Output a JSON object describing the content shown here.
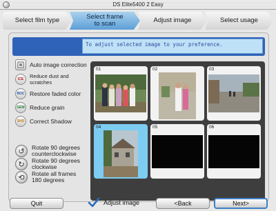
{
  "window": {
    "title": "DS Elite5400 2 Easy"
  },
  "steps": [
    {
      "label": "Select film type"
    },
    {
      "label": "Select frame to scan"
    },
    {
      "label": "Adjust image"
    },
    {
      "label": "Select usage"
    }
  ],
  "active_step": "Select frame to scan",
  "banner": {
    "text": "To adjust selected image to your preference."
  },
  "tools": [
    {
      "label": "Auto image correction",
      "icon": "auto-correction-icon",
      "badge": ""
    },
    {
      "label": "Reduce dust and scratches",
      "icon": "ice-icon",
      "badge": "ICE"
    },
    {
      "label": "Restore faded color",
      "icon": "roc-icon",
      "badge": "ROC"
    },
    {
      "label": "Reduce grain",
      "icon": "gem-icon",
      "badge": "GEM"
    },
    {
      "label": "Correct Shadow",
      "icon": "shadow-icon",
      "badge": "SHD"
    }
  ],
  "rotate": [
    {
      "line1": "Rotate 90 degrees",
      "line2": "counterclockwise",
      "icon": "rotate-ccw-icon"
    },
    {
      "line1": "Rotate 90 degrees",
      "line2": "clockwise",
      "icon": "rotate-cw-icon"
    },
    {
      "line1": "Rotate all frames",
      "line2": "180 degrees",
      "icon": "rotate-180-icon"
    }
  ],
  "frames": [
    {
      "num": "01",
      "selected": false
    },
    {
      "num": "02",
      "selected": false
    },
    {
      "num": "03",
      "selected": false
    },
    {
      "num": "04",
      "selected": true
    },
    {
      "num": "05",
      "selected": false
    },
    {
      "num": "06",
      "selected": false
    }
  ],
  "buttons": {
    "quit": "Quit",
    "back": "<Back",
    "next": "Next>"
  },
  "adjust_checkbox": {
    "label": "Adjust image",
    "checked": true
  },
  "colors": {
    "accent": "#5d9fd6",
    "banner_bg": "#2f63b9",
    "selected_frame": "#7dcdf2"
  }
}
